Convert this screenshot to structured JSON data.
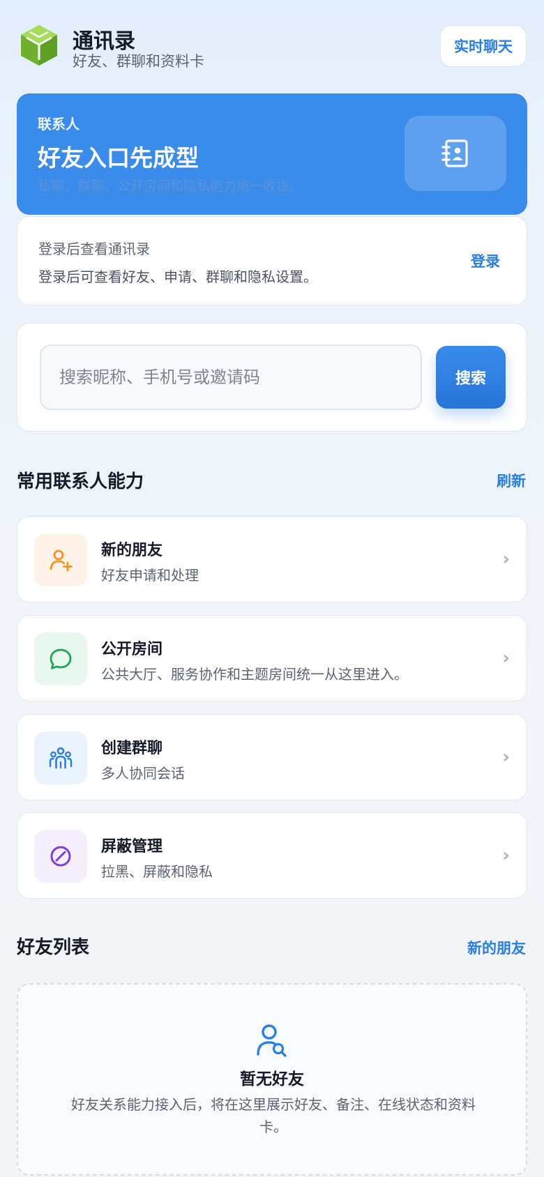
{
  "header": {
    "title": "通讯录",
    "subtitle": "好友、群聊和资料卡",
    "chat_button": "实时聊天"
  },
  "hero": {
    "label": "联系人",
    "title": "好友入口先成型",
    "description": "私聊、群聊、公开房间和隐私能力统一收拢。"
  },
  "login": {
    "title": "登录后查看通讯录",
    "description": "登录后可查看好友、申请、群聊和隐私设置。",
    "link": "登录"
  },
  "search": {
    "placeholder": "搜索昵称、手机号或邀请码",
    "value": "",
    "button": "搜索"
  },
  "common_section": {
    "title": "常用联系人能力",
    "link": "刷新",
    "items": [
      {
        "title": "新的朋友",
        "description": "好友申请和处理",
        "icon": "add-user-icon",
        "color": "#f29325"
      },
      {
        "title": "公开房间",
        "description": "公共大厅、服务协作和主题房间统一从这里进入。",
        "icon": "chat-bubble-icon",
        "color": "#1fa45b"
      },
      {
        "title": "创建群聊",
        "description": "多人协同会话",
        "icon": "group-icon",
        "color": "#2a7fe0"
      },
      {
        "title": "屏蔽管理",
        "description": "拉黑、屏蔽和隐私",
        "icon": "block-icon",
        "color": "#7b3fe0"
      }
    ],
    "chevron": "›"
  },
  "friends_section": {
    "title": "好友列表",
    "link": "新的朋友",
    "empty_title": "暂无好友",
    "empty_description": "好友关系能力接入后，将在这里展示好友、备注、在线状态和资料卡。"
  },
  "colors": {
    "accent": "#2a7fe0",
    "hero_bg": "#3a8bea",
    "logo_green": "#7cc23c"
  }
}
